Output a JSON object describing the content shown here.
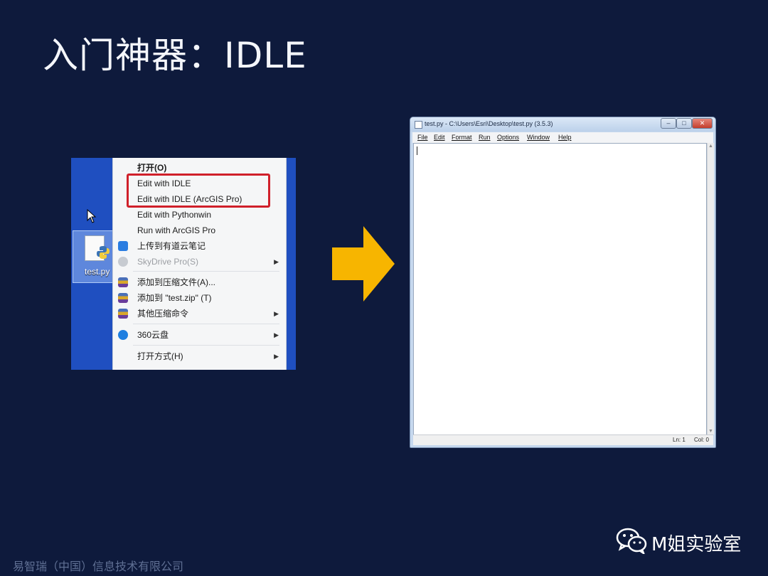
{
  "slide": {
    "title": "入门神器：IDLE",
    "company": "易智瑞（中国）信息技术有限公司",
    "wechat_name": "M姐实验室"
  },
  "desktop": {
    "file_label": "test.py"
  },
  "context_menu": {
    "items": [
      {
        "label": "打开(O)"
      },
      {
        "label": "Edit with IDLE"
      },
      {
        "label": "Edit with IDLE (ArcGIS Pro)"
      },
      {
        "label": "Edit with Pythonwin"
      },
      {
        "label": "Run with ArcGIS Pro"
      },
      {
        "label": "上传到有道云笔记"
      },
      {
        "label": "SkyDrive Pro(S)"
      },
      {
        "label": "添加到压缩文件(A)..."
      },
      {
        "label": "添加到 \"test.zip\" (T)"
      },
      {
        "label": "其他压缩命令"
      },
      {
        "label": "360云盘"
      },
      {
        "label": "打开方式(H)"
      }
    ]
  },
  "idle": {
    "title": "test.py - C:\\Users\\Esri\\Desktop\\test.py (3.5.3)",
    "menus": [
      "File",
      "Edit",
      "Format",
      "Run",
      "Options",
      "Window",
      "Help"
    ],
    "status_ln": "Ln: 1",
    "status_col": "Col: 0"
  },
  "colors": {
    "background": "#0e1a3c",
    "highlight": "#d0202a",
    "arrow": "#f7b500"
  }
}
